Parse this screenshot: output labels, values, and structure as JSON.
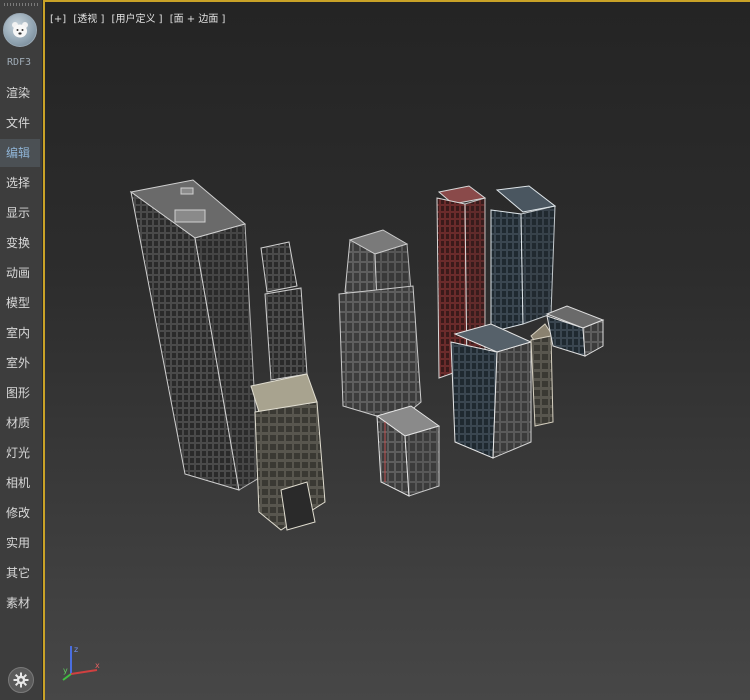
{
  "sidebar": {
    "plugin_name": "RDF3",
    "items": [
      {
        "label": "渲染"
      },
      {
        "label": "文件"
      },
      {
        "label": "编辑",
        "active": true
      },
      {
        "label": "选择"
      },
      {
        "label": "显示"
      },
      {
        "label": "变换"
      },
      {
        "label": "动画"
      },
      {
        "label": "模型"
      },
      {
        "label": "室内"
      },
      {
        "label": "室外"
      },
      {
        "label": "图形"
      },
      {
        "label": "材质"
      },
      {
        "label": "灯光"
      },
      {
        "label": "相机"
      },
      {
        "label": "修改"
      },
      {
        "label": "实用"
      },
      {
        "label": "其它"
      },
      {
        "label": "素材"
      }
    ],
    "logo_icon": "bear-logo-icon",
    "settings_icon": "gear-icon"
  },
  "viewport": {
    "labels": [
      "[+]",
      "[透视 ]",
      "[用户定义 ]",
      "[面 + 边面 ]"
    ],
    "active_border_color": "#c9a227",
    "axis": {
      "x": "x",
      "y": "y",
      "z": "z"
    }
  },
  "colors": {
    "toolbar_bg": "#3d3d3d",
    "active_item_text": "#8fb4d6",
    "viewport_top": "#242424",
    "viewport_bottom": "#474747"
  }
}
